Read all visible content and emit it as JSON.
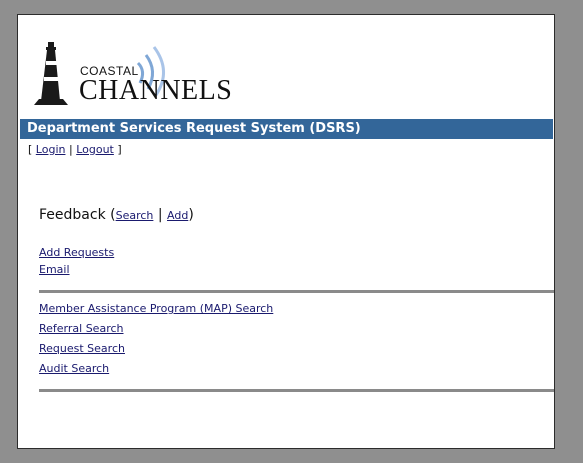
{
  "logo": {
    "line1": "COASTAL",
    "line2": "CHANNELS"
  },
  "header": {
    "title": "Department Services Request System (DSRS)"
  },
  "auth": {
    "open_bracket": "[",
    "login": "Login",
    "separator": "|",
    "logout": "Logout",
    "close_bracket": "]"
  },
  "feedback": {
    "label": "Feedback",
    "open_paren": "(",
    "search": "Search",
    "separator": "|",
    "add": "Add",
    "close_paren": ")"
  },
  "links": {
    "add_requests": "Add Requests",
    "email": "Email",
    "map_search": "Member Assistance Program (MAP) Search",
    "referral_search": "Referral Search",
    "request_search": "Request Search",
    "audit_search": "Audit Search"
  },
  "colors": {
    "title_bar": "#336699",
    "background": "#8f8f8f",
    "link": "#1a1a6e"
  }
}
